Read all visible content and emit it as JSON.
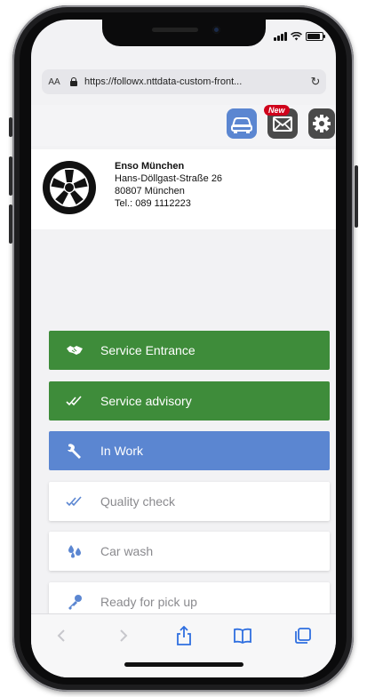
{
  "browser": {
    "text_size_label": "AA",
    "url": "https://followx.nttdata-custom-front...",
    "reload_icon": "reload-icon"
  },
  "header": {
    "badge_new": "New",
    "icons": [
      "car-icon",
      "mail-icon",
      "gear-icon"
    ]
  },
  "dealer": {
    "name": "Enso München",
    "street": "Hans-Döllgast-Straße 26",
    "city": "80807 München",
    "phone": "Tel.: 089 1112223"
  },
  "steps": [
    {
      "label": "Service Entrance",
      "state": "done",
      "icon": "handshake-icon"
    },
    {
      "label": "Service advisory",
      "state": "done",
      "icon": "double-check-icon"
    },
    {
      "label": "In Work",
      "state": "active",
      "icon": "wrench-icon"
    },
    {
      "label": "Quality check",
      "state": "pending",
      "icon": "double-check-icon"
    },
    {
      "label": "Car wash",
      "state": "pending",
      "icon": "water-drops-icon"
    },
    {
      "label": "Ready for pick up",
      "state": "pending",
      "icon": "key-icon"
    }
  ],
  "colors": {
    "done": "#3e8c3a",
    "active": "#5b86d1",
    "pending_text": "#8a8a8e",
    "badge": "#d0021b"
  }
}
